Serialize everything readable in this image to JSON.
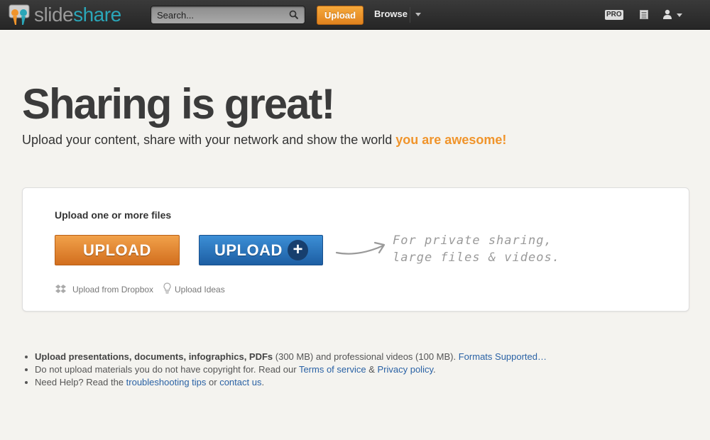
{
  "header": {
    "logo_text_1": "slide",
    "logo_text_2": "share",
    "search_placeholder": "Search...",
    "upload_label": "Upload",
    "browse_label": "Browse",
    "pro_label": "PRO"
  },
  "hero": {
    "title": "Sharing is great!",
    "subtitle_prefix": "Upload your content, share with your network and show the world ",
    "subtitle_accent": "you are awesome!"
  },
  "upload_card": {
    "title": "Upload one or more files",
    "upload_button": "UPLOAD",
    "upload_plus_button": "UPLOAD",
    "plus_symbol": "+",
    "note_line_1": "For private sharing,",
    "note_line_2": "large files & videos.",
    "dropbox_label": "Upload from Dropbox",
    "ideas_label": "Upload Ideas"
  },
  "notes": {
    "line1_bold": "Upload presentations, documents, infographics, PDFs",
    "line1_rest": " (300 MB) and professional videos (100 MB). ",
    "line1_link": "Formats Supported…",
    "line2_text": "Do not upload materials you do not have copyright for. Read our ",
    "line2_link1": "Terms of service",
    "line2_amp": " & ",
    "line2_link2": "Privacy policy",
    "line2_end": ".",
    "line3_text": "Need Help? Read the ",
    "line3_link1": "troubleshooting tips",
    "line3_or": " or ",
    "line3_link2": "contact us",
    "line3_end": "."
  },
  "colors": {
    "accent_orange": "#f0942b",
    "brand_teal": "#2aa6b8",
    "link_blue": "#2a62a5",
    "upload_blue": "#1d5ea3"
  }
}
